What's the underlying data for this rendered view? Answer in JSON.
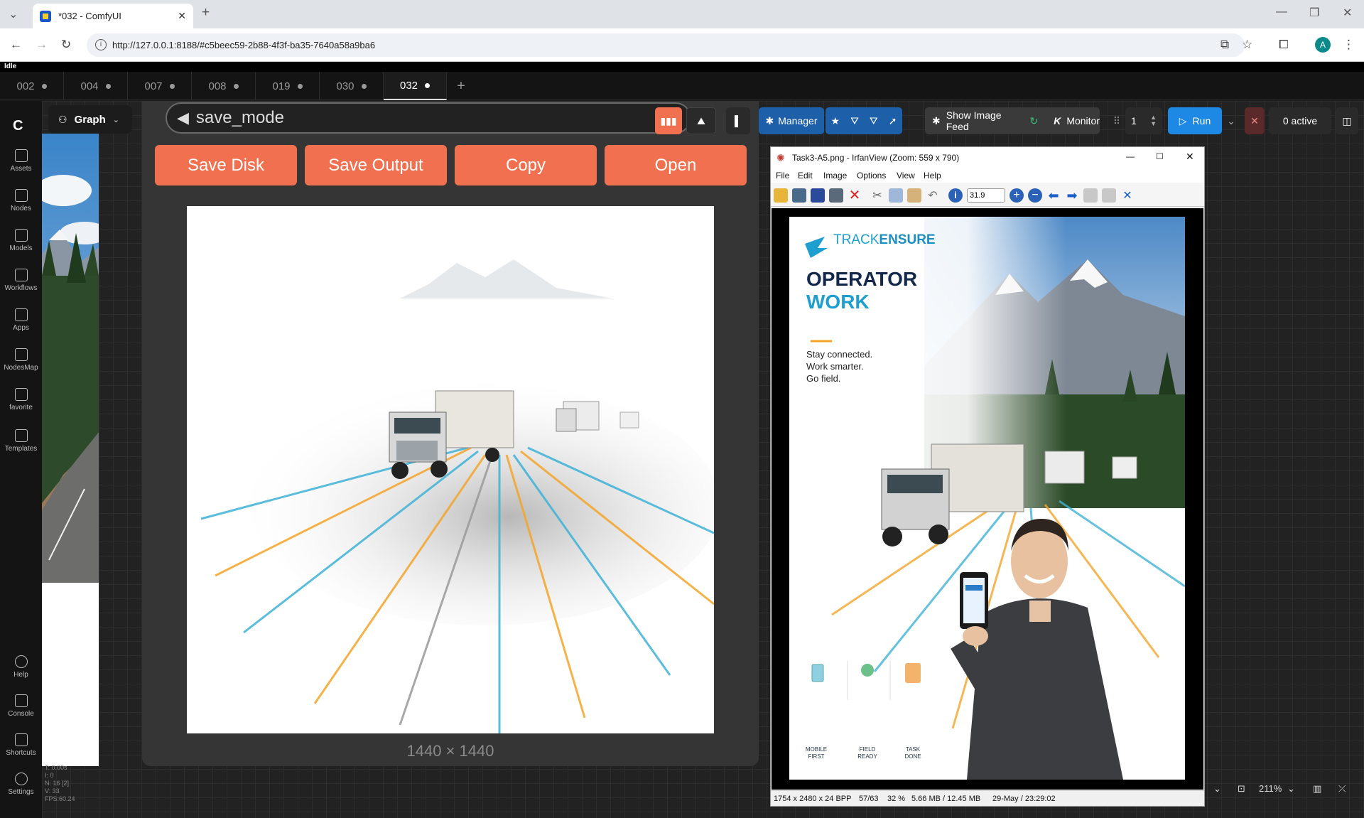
{
  "browser": {
    "tab_title": "*032 - ComfyUI",
    "url": "http://127.0.0.1:8188/#c5beec59-2b88-4f3f-ba35-7640a58a9ba6",
    "profile_initial": "A"
  },
  "status": "Idle",
  "workflow_tabs": [
    {
      "label": "002",
      "active": false
    },
    {
      "label": "004",
      "active": false
    },
    {
      "label": "007",
      "active": false
    },
    {
      "label": "008",
      "active": false
    },
    {
      "label": "019",
      "active": false
    },
    {
      "label": "030",
      "active": false
    },
    {
      "label": "032",
      "active": true
    }
  ],
  "sidebar": [
    {
      "label": "Assets",
      "icon": "image-icon"
    },
    {
      "label": "Nodes",
      "icon": "node-icon"
    },
    {
      "label": "Models",
      "icon": "models-icon"
    },
    {
      "label": "Workflows",
      "icon": "workflow-icon"
    },
    {
      "label": "Apps",
      "icon": "apps-icon"
    },
    {
      "label": "NodesMap",
      "icon": "nodesmap-icon"
    },
    {
      "label": "favorite",
      "icon": "star-icon"
    },
    {
      "label": "Templates",
      "icon": "templates-icon"
    },
    {
      "label": "Help",
      "icon": "help-icon"
    },
    {
      "label": "Console",
      "icon": "console-icon"
    },
    {
      "label": "Shortcuts",
      "icon": "keyboard-icon"
    },
    {
      "label": "Settings",
      "icon": "gear-icon"
    }
  ],
  "graph_button": "Graph",
  "node": {
    "save_mode": "save_mode",
    "buttons": [
      "Save Disk",
      "Save Output",
      "Copy",
      "Open"
    ],
    "dims": "1440 × 1440"
  },
  "toolbar": {
    "manager": "Manager",
    "show_image_feed": "Show Image Feed",
    "monitor": "Monitor",
    "batch_count": "1",
    "run": "Run",
    "active": "0 active"
  },
  "irfanview": {
    "title": "Task3-A5.png - IrfanView (Zoom: 559 x 790)",
    "menu": [
      "File",
      "Edit",
      "Image",
      "Options",
      "View",
      "Help"
    ],
    "zoom_value": "31.9",
    "status": [
      "1754 x 2480 x 24 BPP",
      "57/63",
      "32 %",
      "5.66 MB / 12.45 MB",
      "29-May / 23:29:02"
    ]
  },
  "poster": {
    "brand_a": "TRACK",
    "brand_b": "ENSURE",
    "headline_1": "OPERATOR",
    "headline_2": "WORK",
    "tagline_1": "Stay connected.",
    "tagline_2": "Work smarter.",
    "tagline_3": "Go field.",
    "features": [
      {
        "l1": "MOBILE",
        "l2": "FIRST"
      },
      {
        "l1": "FIELD",
        "l2": "READY"
      },
      {
        "l1": "TASK",
        "l2": "DONE"
      }
    ]
  },
  "stats": [
    "T: 0.00s",
    "I: 0",
    "N: 16 [2]",
    "V: 33",
    "FPS:60.24"
  ],
  "zoom": "211%",
  "colors": {
    "accent_orange": "#f0704f",
    "run_blue": "#1e88e5",
    "manager_blue": "#1d5fa8"
  }
}
